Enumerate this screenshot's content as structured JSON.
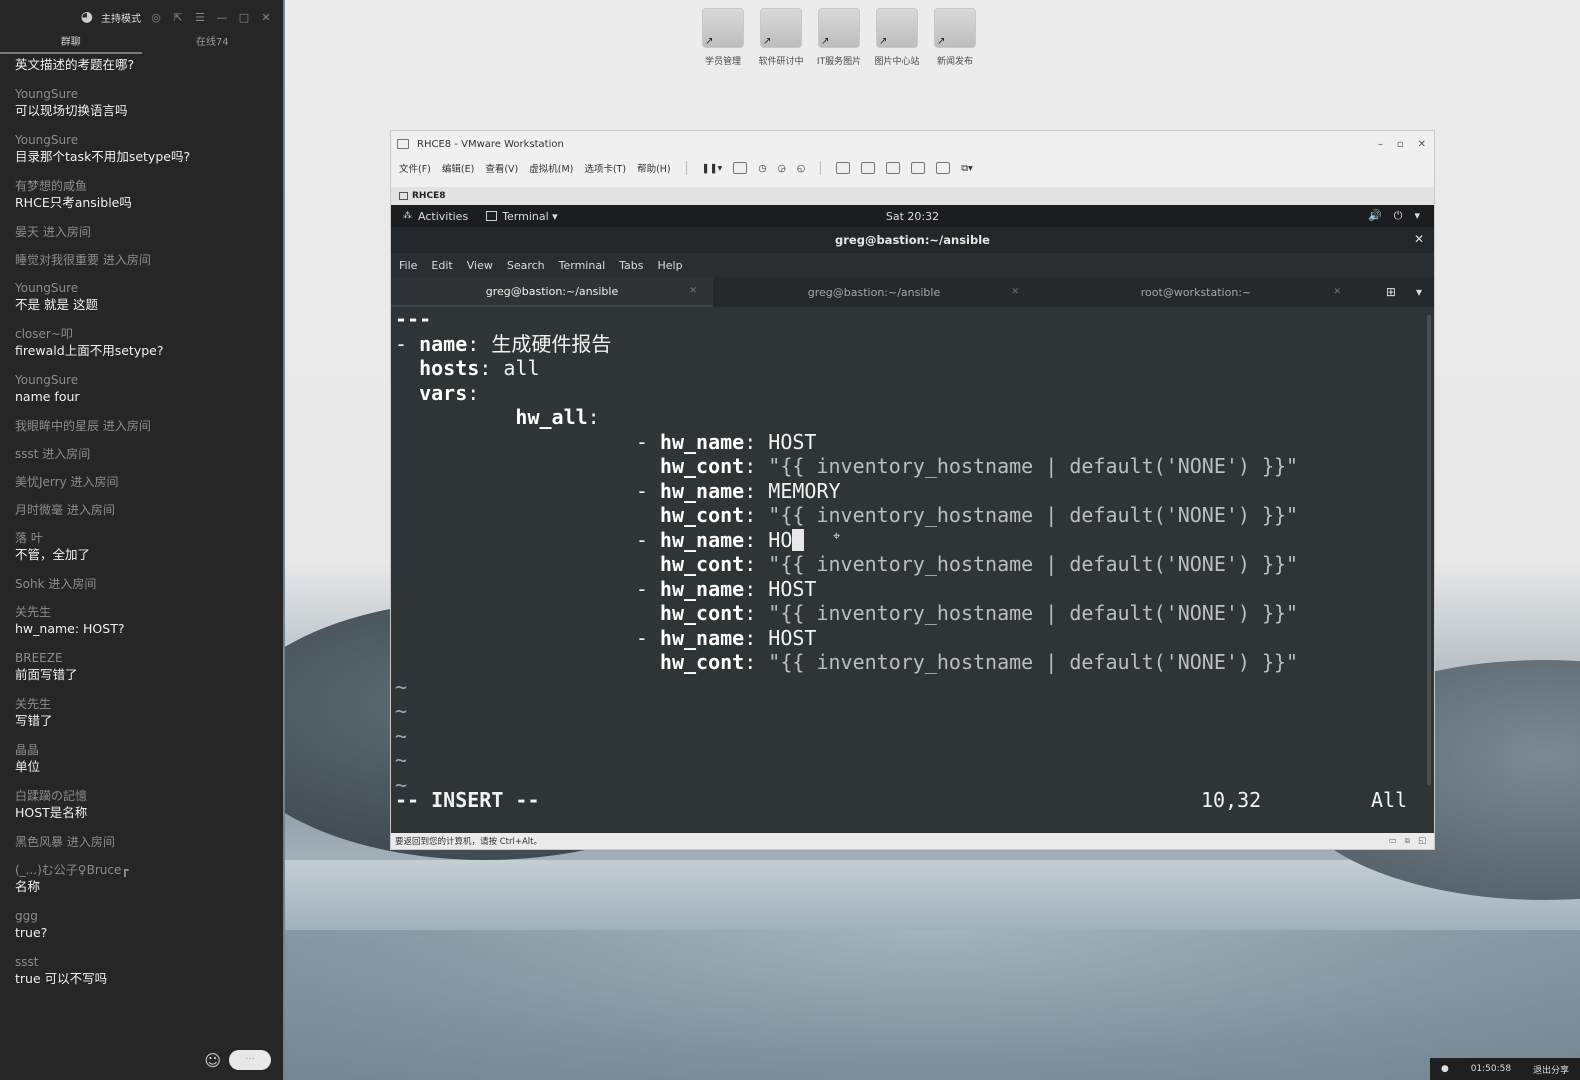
{
  "chat": {
    "mode_label": "主持模式",
    "tabs": [
      "群聊",
      "在线74"
    ],
    "messages": [
      {
        "user": "",
        "text": "英文描述的考题在哪?"
      },
      {
        "user": "YoungSure",
        "text": "可以现场切换语言吗"
      },
      {
        "user": "YoungSure",
        "text": "目录那个task不用加setype吗?"
      },
      {
        "user": "有梦想的咸鱼",
        "text": "RHCE只考ansible吗"
      },
      {
        "user": "晏天 进入房间",
        "text": ""
      },
      {
        "user": "睡觉对我很重要 进入房间",
        "text": ""
      },
      {
        "user": "YoungSure",
        "text": "不是  就是 这题"
      },
      {
        "user": "closer~叩",
        "text": "firewald上面不用setype?"
      },
      {
        "user": "YoungSure",
        "text": "name four"
      },
      {
        "user": "我眼眸中的星辰 进入房间",
        "text": ""
      },
      {
        "user": "ssst 进入房间",
        "text": ""
      },
      {
        "user": "美忧Jerry 进入房间",
        "text": ""
      },
      {
        "user": "月时微毫 进入房间",
        "text": ""
      },
      {
        "user": "  落  叶",
        "text": "不管，全加了"
      },
      {
        "user": "Sohk 进入房间",
        "text": ""
      },
      {
        "user": "关先生",
        "text": "hw_name: HOST?"
      },
      {
        "user": "BREEZE",
        "text": "前面写错了"
      },
      {
        "user": "关先生",
        "text": "写错了"
      },
      {
        "user": "晶晶",
        "text": "单位"
      },
      {
        "user": "白蹂躏の記憶",
        "text": "HOST是名称"
      },
      {
        "user": "黑色风暴 进入房间",
        "text": ""
      },
      {
        "user": "(_...)む公子♀Bruce┏",
        "text": "名称"
      },
      {
        "user": "ggg",
        "text": "true?"
      },
      {
        "user": "ssst",
        "text": "true 可以不写吗"
      }
    ],
    "send_pill": "···"
  },
  "desktop_icons": [
    {
      "label": "学员管理"
    },
    {
      "label": "软件研讨中"
    },
    {
      "label": "IT服务图片"
    },
    {
      "label": "图片中心站"
    },
    {
      "label": "新闻发布"
    }
  ],
  "vmware": {
    "title": "RHCE8 - VMware Workstation",
    "menu": [
      "文件(F)",
      "编辑(E)",
      "查看(V)",
      "虚拟机(M)",
      "选项卡(T)",
      "帮助(H)"
    ],
    "vm_tab": "RHCE8",
    "status_hint": "要返回到您的计算机，请按 Ctrl+Alt。"
  },
  "gnome": {
    "activities": "Activities",
    "app_menu": "Terminal ▾",
    "clock": "Sat 20:32"
  },
  "terminal": {
    "title": "greg@bastion:~/ansible",
    "menu": [
      "File",
      "Edit",
      "View",
      "Search",
      "Terminal",
      "Tabs",
      "Help"
    ],
    "tabs": [
      "greg@bastion:~/ansible",
      "greg@bastion:~/ansible",
      "root@workstation:~"
    ]
  },
  "vim": {
    "lines": [
      {
        "indent": "",
        "key": "---",
        "sep": "",
        "val": ""
      },
      {
        "indent": "- ",
        "key": "name",
        "sep": ": ",
        "val": "生成硬件报告"
      },
      {
        "indent": "  ",
        "key": "hosts",
        "sep": ": ",
        "val": "all"
      },
      {
        "indent": "  ",
        "key": "vars",
        "sep": ":",
        "val": ""
      },
      {
        "indent": "          ",
        "key": "hw_all",
        "sep": ":",
        "val": ""
      },
      {
        "indent": "                    - ",
        "key": "hw_name",
        "sep": ": ",
        "val": "HOST"
      },
      {
        "indent": "                      ",
        "key": "hw_cont",
        "sep": ": ",
        "val": "\"{{ inventory_hostname | default('NONE') }}\""
      },
      {
        "indent": "                    - ",
        "key": "hw_name",
        "sep": ": ",
        "val": "MEMORY"
      },
      {
        "indent": "                      ",
        "key": "hw_cont",
        "sep": ": ",
        "val": "\"{{ inventory_hostname | default('NONE') }}\""
      },
      {
        "indent": "                    - ",
        "key": "hw_name",
        "sep": ": ",
        "val": "HO"
      },
      {
        "indent": "                      ",
        "key": "hw_cont",
        "sep": ": ",
        "val": "\"{{ inventory_hostname | default('NONE') }}\""
      },
      {
        "indent": "                    - ",
        "key": "hw_name",
        "sep": ": ",
        "val": "HOST"
      },
      {
        "indent": "                      ",
        "key": "hw_cont",
        "sep": ": ",
        "val": "\"{{ inventory_hostname | default('NONE') }}\""
      },
      {
        "indent": "                    - ",
        "key": "hw_name",
        "sep": ": ",
        "val": "HOST"
      },
      {
        "indent": "                      ",
        "key": "hw_cont",
        "sep": ": ",
        "val": "\"{{ inventory_hostname | default('NONE') }}\""
      }
    ],
    "empty_markers": [
      "~",
      "~",
      "~",
      "~",
      "~"
    ],
    "mode": "-- INSERT --",
    "position": "10,32",
    "percent": "All"
  },
  "tray": {
    "time": "01:50:58",
    "exit_label": "退出分享"
  }
}
